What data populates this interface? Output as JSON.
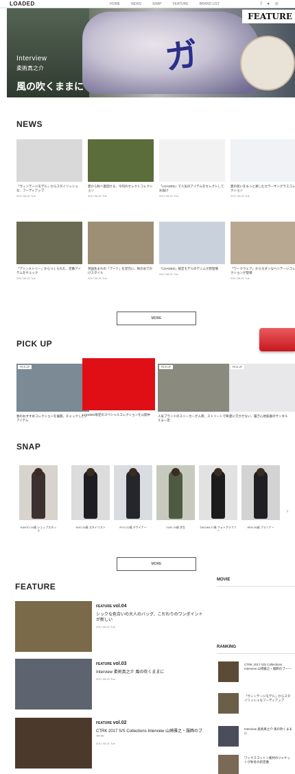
{
  "header": {
    "logo": "LOADED",
    "nav": [
      "HOME",
      "NEWS",
      "SNAP",
      "FEATURE",
      "BRAND LIST"
    ],
    "icons": "f ● ◎"
  },
  "hero": {
    "tag": "FEATURE",
    "interview": "Interview",
    "name": "柔術真之介",
    "title": "風の吹くままに",
    "kanji": "ガ"
  },
  "news": {
    "heading": "NEWS",
    "items": [
      {
        "caption": "「ヴィンテージモデル」からスタイリッシュな、フーディアップ",
        "meta": "2017.08.21 Tue",
        "bg": "#d9d9d9"
      },
      {
        "caption": "夏から秋へ着回せる、今旬のセレクトコレクション",
        "meta": "2017.08.21 Tue",
        "bg": "#5b6d3a"
      },
      {
        "caption": "「LOADED」で人気のアイテムをセレクトしてお届け",
        "meta": "2017.08.21 Tue",
        "bg": "#f2f2f2"
      },
      {
        "caption": "夏の装いをもっと楽しむカラーサングラスコレクション",
        "meta": "2017.08.21 Tue",
        "bg": "#f0f2f5"
      },
      {
        "caption": "「アシンメトリー」からつくられた、定番アイテムをチェック",
        "meta": "2017.08.21 Tue",
        "bg": "#6a6b52"
      },
      {
        "caption": "英国生まれの「ブーツ」を足元に、秋のおでかけスタイル",
        "meta": "2017.08.21 Tue",
        "bg": "#9c8f75"
      },
      {
        "caption": "「LOADED」限定モデルのデニムが新登場",
        "meta": "2017.08.21 Tue",
        "bg": "#c9d2dc"
      },
      {
        "caption": "「ワークウェア」からモダンなヘリテージコレクションが登場",
        "meta": "2017.08.21 Tue",
        "bg": "#b9a891"
      }
    ],
    "more": "MORE"
  },
  "pickup": {
    "heading": "PICK UP",
    "items": [
      {
        "tag": "PICK UP",
        "caption": "春のおすすめコレクションを展開、チェックしたいアイテム",
        "bg": "#7b8a95"
      },
      {
        "tag": "",
        "caption": "LOADED限定のスペシャルコレクションを公開中",
        "bg": "#e00f16"
      },
      {
        "tag": "PICK UP",
        "caption": "人気ブランドのスニーカーが入荷、ストリートで映える一足",
        "bg": "#8a8a7e"
      },
      {
        "tag": "PICK UP",
        "caption": "夏に欠かせない、履き心地抜群のサンダル",
        "bg": "#e8e8ea"
      }
    ]
  },
  "snap": {
    "heading": "SNAP",
    "items": [
      {
        "caption": "KANTO 23歳 ショップスタッフ",
        "bg": "#d8d3cc",
        "body": "#3d3030"
      },
      {
        "caption": "SHO 25歳 スタイリスト",
        "bg": "#dcdcdc",
        "body": "#1e1e22"
      },
      {
        "caption": "RYO 22歳 デザイナー",
        "bg": "#d9dde2",
        "body": "#24262c"
      },
      {
        "caption": "YUKI 24歳 学生",
        "bg": "#c6cbbd",
        "body": "#4f5a44"
      },
      {
        "caption": "TAKUMI 27歳 フォトグラファー",
        "bg": "#e2e2e2",
        "body": "#1c1c1c"
      },
      {
        "caption": "REN 26歳 プランナー",
        "bg": "#d3d3d3",
        "body": "#202024"
      }
    ],
    "more": "MORE",
    "prev": "‹",
    "next": "›"
  },
  "feature": {
    "heading": "FEATURE",
    "items": [
      {
        "label": "FEATURE",
        "vol": "vol.04",
        "title": "シックな色合いの大人のバッグ、こだわりのワンポイントが新しい",
        "date": "2017.08.21 Tue",
        "bg": "#7a6a4a"
      },
      {
        "label": "FEATURE",
        "vol": "vol.03",
        "title": "Interview 柔術真之介 風の吹くままに",
        "date": "2017.08.21 Tue",
        "bg": "#5d6470"
      },
      {
        "label": "FEATURE",
        "vol": "vol.02",
        "title": "CTRK 2017 S/S Collections Interview 山崎雅之・服飾のブーー",
        "date": "2017.08.21 Tue",
        "bg": "#4b3a2c"
      }
    ]
  },
  "sidebar": {
    "movie": "MOVIE",
    "ranking": "RANKING",
    "ranks": [
      {
        "text": "CTRK 2017 S/S Collections Interview 山崎雅之・服飾のブーー",
        "bg": "#5a4a36"
      },
      {
        "text": "「ヴィンテージモデル」からスタイリッシュなフーディアップ",
        "bg": "#6b5f4a"
      },
      {
        "text": "Interview 柔術真之介 風の吹くままに",
        "bg": "#4a4e5c"
      },
      {
        "text": "ワックスコットン素材のジャケットが秋冬の新定番",
        "bg": "#7a6a55"
      }
    ]
  },
  "colors": {
    "accent": "#e00f16",
    "button_red": "#d6282e"
  }
}
